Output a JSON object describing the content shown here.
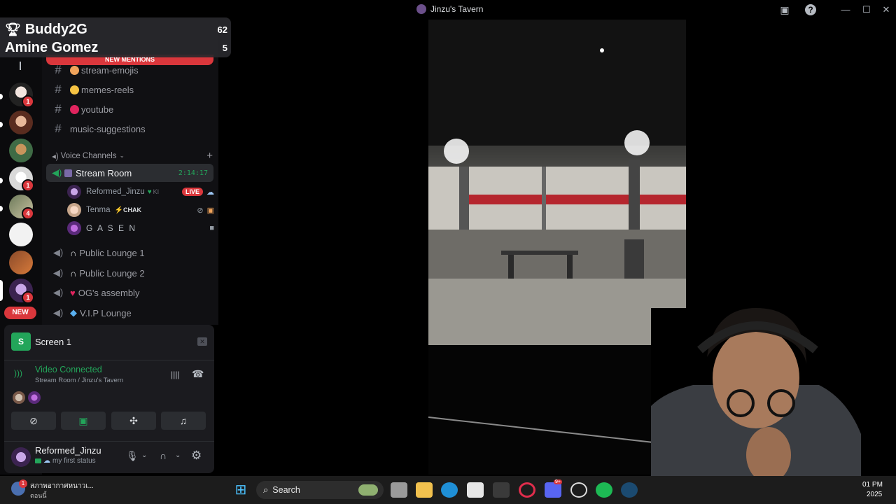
{
  "window": {
    "title": "Jinzu's Tavern"
  },
  "score": {
    "player1_name": "Buddy2G",
    "player1_score": "62",
    "player2_name": "Amine Gomez",
    "player2_score": "5"
  },
  "rail": {
    "badges": [
      "1",
      "1",
      "4",
      "1"
    ],
    "new_label": "NEW"
  },
  "channels": {
    "new_mentions": "NEW MENTIONS",
    "text_channels": [
      {
        "name": "stream-emojis",
        "emoji_color": "#f0a35b"
      },
      {
        "name": "memes-reels",
        "emoji_color": "#f6c343"
      },
      {
        "name": "youtube",
        "emoji_color": "#e0245e"
      },
      {
        "name": "music-suggestions",
        "emoji_color": ""
      }
    ],
    "voice_header": "Voice Channels",
    "active_voice": {
      "name": "Stream Room",
      "time": "2:14:17"
    },
    "members": [
      {
        "name": "Reformed_Jinzu",
        "tag": "KI",
        "status": "LIVE"
      },
      {
        "name": "Tenma",
        "tag": "CHAK"
      },
      {
        "name": "G A S E N"
      }
    ],
    "voice_channels": [
      {
        "name": "Public Lounge 1"
      },
      {
        "name": "Public Lounge 2"
      },
      {
        "name": "OG's assembly"
      },
      {
        "name": "V.I.P Lounge"
      }
    ]
  },
  "panel": {
    "screen_icon": "S",
    "screen_label": "Screen 1",
    "video_status": "Video Connected",
    "video_location": "Stream Room / Jinzu's Tavern",
    "user_name": "Reformed_Jinzu",
    "user_status": "my first status"
  },
  "taskbar": {
    "weather_badge": "1",
    "weather_line1": "สภาพอากาศหนาวเ...",
    "weather_line2": "ตอนนี้",
    "search_label": "Search",
    "discord_badge": "9+",
    "clock_time": "01 PM",
    "clock_date": "2025"
  },
  "colors": {
    "accent_green": "#23a55a",
    "alert_red": "#da373c",
    "background": "#000000"
  }
}
